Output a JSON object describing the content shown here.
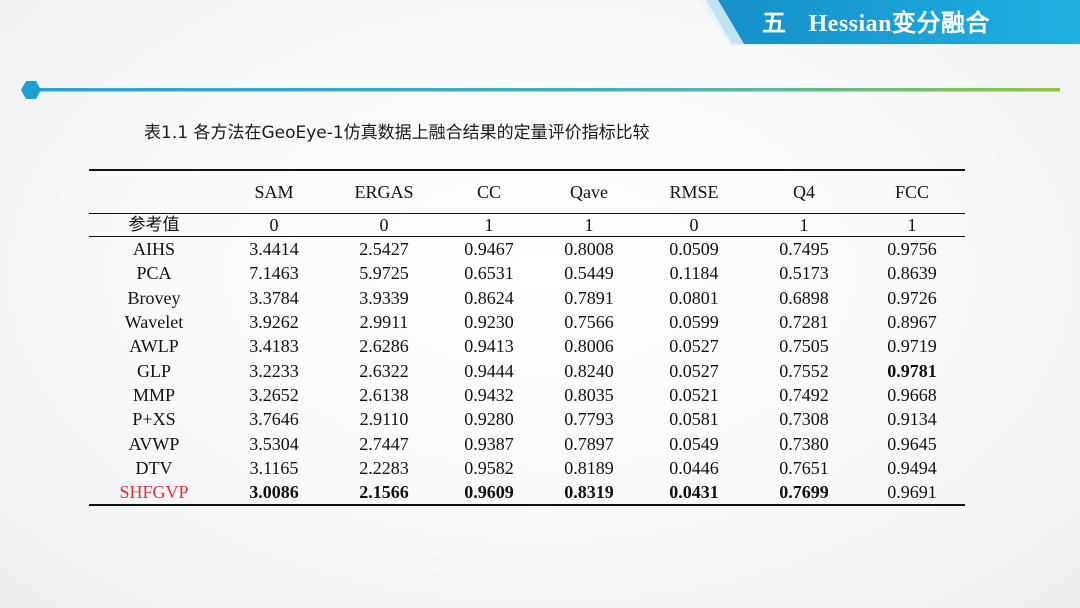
{
  "header": {
    "section_number": "五",
    "section_title": "Hessian变分融合",
    "banner_color": "#1aa7d8"
  },
  "divider": {
    "line_color": "#2aa3d6",
    "accent_color": "#8dc63f",
    "hexagon_color": "#1f9fd4"
  },
  "caption": "表1.1 各方法在GeoEye-1仿真数据上融合结果的定量评价指标比较",
  "table": {
    "columns": [
      "",
      "SAM",
      "ERGAS",
      "CC",
      "Qave",
      "RMSE",
      "Q4",
      "FCC"
    ],
    "reference": {
      "label": "参考值",
      "values": [
        "0",
        "0",
        "1",
        "1",
        "0",
        "1",
        "1"
      ]
    },
    "rows": [
      {
        "method": "AIHS",
        "values": [
          "3.4414",
          "2.5427",
          "0.9467",
          "0.8008",
          "0.0509",
          "0.7495",
          "0.9756"
        ]
      },
      {
        "method": "PCA",
        "values": [
          "7.1463",
          "5.9725",
          "0.6531",
          "0.5449",
          "0.1184",
          "0.5173",
          "0.8639"
        ]
      },
      {
        "method": "Brovey",
        "values": [
          "3.3784",
          "3.9339",
          "0.8624",
          "0.7891",
          "0.0801",
          "0.6898",
          "0.9726"
        ]
      },
      {
        "method": "Wavelet",
        "values": [
          "3.9262",
          "2.9911",
          "0.9230",
          "0.7566",
          "0.0599",
          "0.7281",
          "0.8967"
        ]
      },
      {
        "method": "AWLP",
        "values": [
          "3.4183",
          "2.6286",
          "0.9413",
          "0.8006",
          "0.0527",
          "0.7505",
          "0.9719"
        ]
      },
      {
        "method": "GLP",
        "values": [
          "3.2233",
          "2.6322",
          "0.9444",
          "0.8240",
          "0.0527",
          "0.7552",
          "0.9781"
        ]
      },
      {
        "method": "MMP",
        "values": [
          "3.2652",
          "2.6138",
          "0.9432",
          "0.8035",
          "0.0521",
          "0.7492",
          "0.9668"
        ]
      },
      {
        "method": "P+XS",
        "values": [
          "3.7646",
          "2.9110",
          "0.9280",
          "0.7793",
          "0.0581",
          "0.7308",
          "0.9134"
        ]
      },
      {
        "method": "AVWP",
        "values": [
          "3.5304",
          "2.7447",
          "0.9387",
          "0.7897",
          "0.0549",
          "0.7380",
          "0.9645"
        ]
      },
      {
        "method": "DTV",
        "values": [
          "3.1165",
          "2.2283",
          "0.9582",
          "0.8189",
          "0.0446",
          "0.7651",
          "0.9494"
        ]
      },
      {
        "method": "SHFGVP",
        "values": [
          "3.0086",
          "2.1566",
          "0.9609",
          "0.8319",
          "0.0431",
          "0.7699",
          "0.9691"
        ]
      }
    ],
    "highlight_method_color": "#e03030"
  }
}
